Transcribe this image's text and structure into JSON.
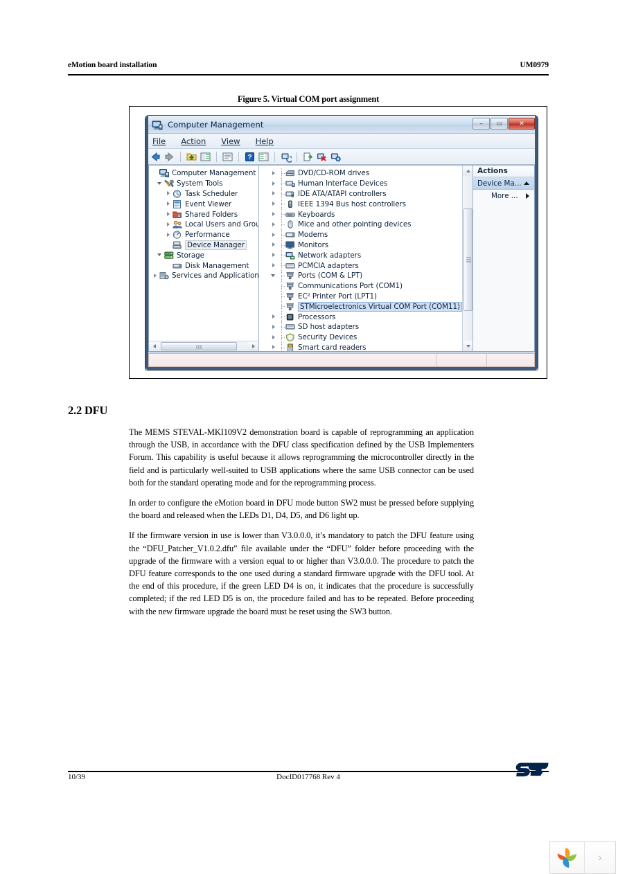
{
  "header": {
    "left": "eMotion board installation",
    "right": "UM0979"
  },
  "figure": {
    "caption": "Figure 5. Virtual COM port assignment"
  },
  "window": {
    "title": "Computer Management",
    "title_icon": "computer-management-icon",
    "window_controls": {
      "minimize": "–",
      "maximize": "▭",
      "close": "✕"
    },
    "menu": [
      "File",
      "Action",
      "View",
      "Help"
    ],
    "toolbar_icons": [
      "back-arrow-icon",
      "forward-arrow-icon",
      "up-folder-icon",
      "show-hide-console-tree-icon",
      "properties-icon",
      "help-icon",
      "show-hide-action-pane-icon",
      "scan-for-hardware-changes-icon",
      "update-driver-icon",
      "disable-device-icon",
      "uninstall-device-icon"
    ],
    "left_tree": [
      {
        "label": "Computer Management (Local",
        "icon": "computer-icon",
        "twist": "none",
        "depth": 0
      },
      {
        "label": "System Tools",
        "icon": "system-tools-icon",
        "twist": "expanded",
        "depth": 1
      },
      {
        "label": "Task Scheduler",
        "icon": "clock-icon",
        "twist": "collapsed",
        "depth": 2
      },
      {
        "label": "Event Viewer",
        "icon": "event-viewer-icon",
        "twist": "collapsed",
        "depth": 2
      },
      {
        "label": "Shared Folders",
        "icon": "shared-folders-icon",
        "twist": "collapsed",
        "depth": 2
      },
      {
        "label": "Local Users and Groups",
        "icon": "users-icon",
        "twist": "collapsed",
        "depth": 2
      },
      {
        "label": "Performance",
        "icon": "performance-icon",
        "twist": "collapsed",
        "depth": 2
      },
      {
        "label": "Device Manager",
        "icon": "device-manager-icon",
        "twist": "none",
        "depth": 2,
        "selected": "gray"
      },
      {
        "label": "Storage",
        "icon": "storage-icon",
        "twist": "expanded",
        "depth": 1
      },
      {
        "label": "Disk Management",
        "icon": "disk-management-icon",
        "twist": "none",
        "depth": 2
      },
      {
        "label": "Services and Applications",
        "icon": "services-icon",
        "twist": "collapsed",
        "depth": 1
      }
    ],
    "device_tree": [
      {
        "label": "DVD/CD-ROM drives",
        "icon": "dvd-drive-icon",
        "twist": "collapsed",
        "depth": 1
      },
      {
        "label": "Human Interface Devices",
        "icon": "hid-icon",
        "twist": "collapsed",
        "depth": 1
      },
      {
        "label": "IDE ATA/ATAPI controllers",
        "icon": "ide-controller-icon",
        "twist": "collapsed",
        "depth": 1
      },
      {
        "label": "IEEE 1394 Bus host controllers",
        "icon": "ieee1394-icon",
        "twist": "collapsed",
        "depth": 1
      },
      {
        "label": "Keyboards",
        "icon": "keyboard-icon",
        "twist": "collapsed",
        "depth": 1
      },
      {
        "label": "Mice and other pointing devices",
        "icon": "mouse-icon",
        "twist": "collapsed",
        "depth": 1
      },
      {
        "label": "Modems",
        "icon": "modem-icon",
        "twist": "collapsed",
        "depth": 1
      },
      {
        "label": "Monitors",
        "icon": "monitor-icon",
        "twist": "collapsed",
        "depth": 1
      },
      {
        "label": "Network adapters",
        "icon": "network-adapter-icon",
        "twist": "collapsed",
        "depth": 1
      },
      {
        "label": "PCMCIA adapters",
        "icon": "pcmcia-icon",
        "twist": "collapsed",
        "depth": 1
      },
      {
        "label": "Ports (COM & LPT)",
        "icon": "port-icon",
        "twist": "expanded",
        "depth": 1
      },
      {
        "label": "Communications Port (COM1)",
        "icon": "port-icon",
        "twist": "none",
        "depth": 2
      },
      {
        "label": "EC² Printer Port (LPT1)",
        "icon": "port-icon",
        "twist": "none",
        "depth": 2
      },
      {
        "label": "STMicroelectronics Virtual COM Port (COM11)",
        "icon": "port-icon",
        "twist": "none",
        "depth": 2,
        "selected": "blue"
      },
      {
        "label": "Processors",
        "icon": "processor-icon",
        "twist": "collapsed",
        "depth": 1
      },
      {
        "label": "SD host adapters",
        "icon": "sd-host-icon",
        "twist": "collapsed",
        "depth": 1
      },
      {
        "label": "Security Devices",
        "icon": "security-device-icon",
        "twist": "collapsed",
        "depth": 1
      },
      {
        "label": "Smart card readers",
        "icon": "smart-card-reader-icon",
        "twist": "collapsed",
        "depth": 1
      }
    ],
    "actions": {
      "header": "Actions",
      "rows": [
        {
          "label": "Device Ma...",
          "caret": "caret-up-icon",
          "highlighted": true
        },
        {
          "label": "More ...",
          "caret": "caret-right-icon",
          "highlighted": false
        }
      ]
    }
  },
  "section": {
    "number_title": "2.2 DFU",
    "paragraphs": [
      "The MEMS STEVAL-MKI109V2 demonstration board is capable of reprogramming an application through the USB, in accordance with the DFU class specification defined by the USB Implementers Forum. This capability is useful because it allows reprogramming the microcontroller directly in the field and is particularly well-suited to USB applications where the same USB connector can be used both for the standard operating mode and for the reprogramming process.",
      "In order to configure the eMotion board in DFU mode button SW2 must be pressed before supplying the board and released when the LEDs D1, D4, D5, and D6 light up.",
      "If the firmware version in use is lower than V3.0.0.0, it’s mandatory to patch the DFU feature using the “DFU_Patcher_V1.0.2.dfu” file available under the “DFU” folder before proceeding with the upgrade of the firmware with a version equal to or higher than V3.0.0.0. The procedure to patch the DFU feature corresponds to the one used during a standard firmware upgrade with the DFU tool. At the end of this procedure, if the green LED D4 is on, it indicates that the procedure is successfully completed; if the red LED D5 is on, the procedure failed and has to be repeated. Before proceeding with the new firmware upgrade the board must be reset using the SW3 button."
    ]
  },
  "footer": {
    "page": "10/39",
    "doc_id": "DocID017768 Rev 4",
    "logo": "st-logo"
  },
  "widget": {
    "logo": "leaf-pinwheel-logo",
    "next": "›"
  },
  "colors": {
    "accent_blue": "#1e5799",
    "st_blue": "#03234b",
    "selection_blue": "#cfe0f5",
    "close_red": "#b63126"
  }
}
